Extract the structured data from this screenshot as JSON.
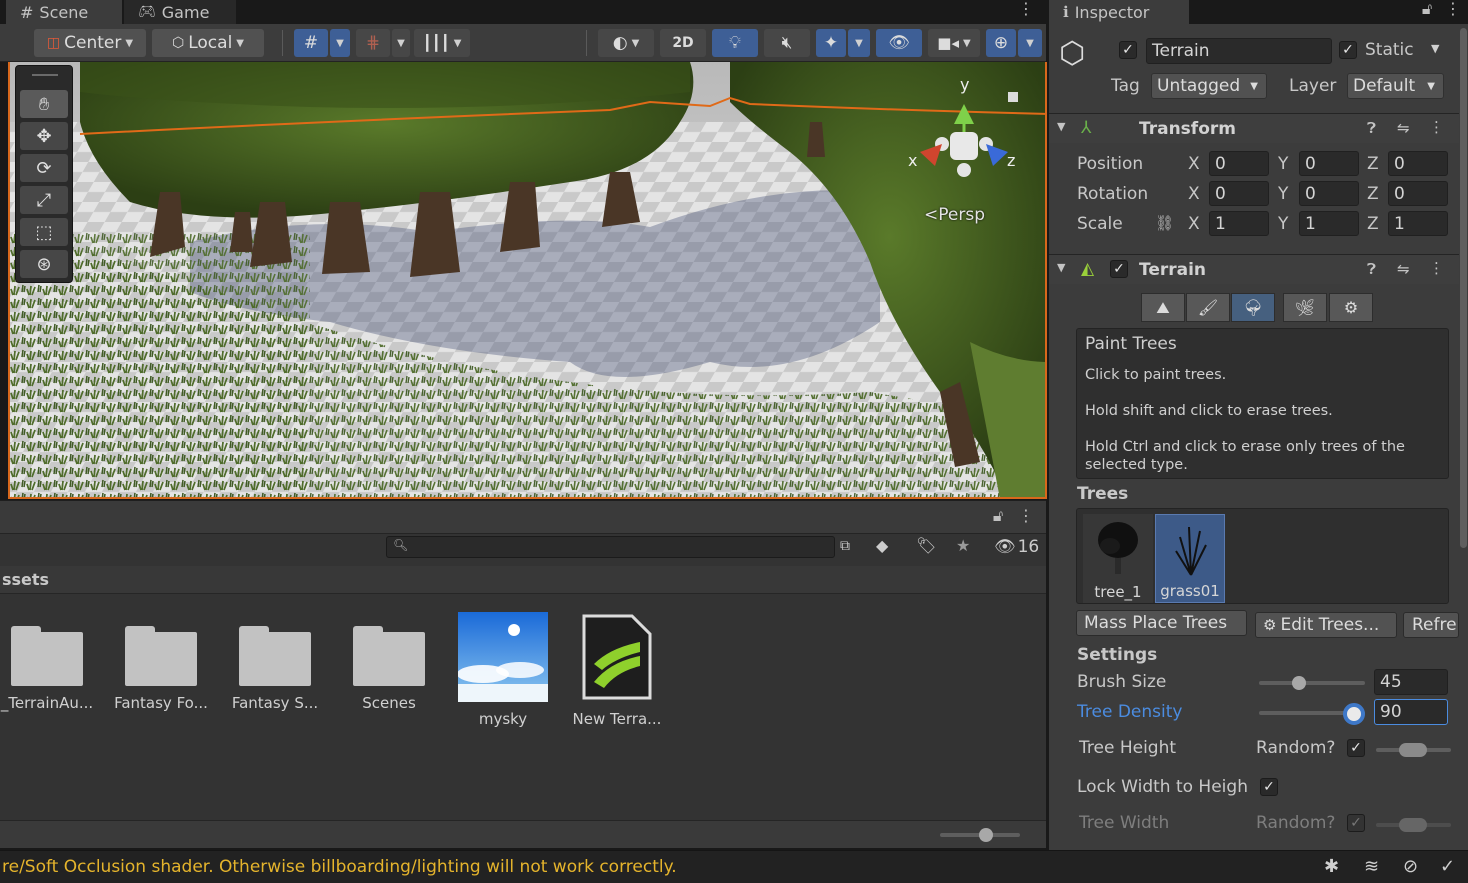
{
  "scene_window": {
    "tab_scene": "Scene",
    "tab_game": "Game",
    "pivot_mode": "Center",
    "pivot_rotation": "Local",
    "mode_2d": "2D",
    "orientation_label": "Persp",
    "gizmo_axes": {
      "x": "x",
      "y": "y",
      "z": "z"
    }
  },
  "project_window": {
    "search": {
      "value": "",
      "placeholder": ""
    },
    "hidden_count": "16",
    "breadcrumb": "ssets",
    "assets": [
      {
        "name": "_TerrainAu...",
        "kind": "folder"
      },
      {
        "name": "Fantasy Fo...",
        "kind": "folder"
      },
      {
        "name": "Fantasy S...",
        "kind": "folder"
      },
      {
        "name": "Scenes",
        "kind": "folder"
      },
      {
        "name": "mysky",
        "kind": "texture"
      },
      {
        "name": "New Terra...",
        "kind": "terrain-data"
      }
    ]
  },
  "status_bar": {
    "message": "re/Soft Occlusion shader. Otherwise billboarding/lighting will not work correctly."
  },
  "inspector": {
    "tab": "Inspector",
    "object": {
      "active": true,
      "name": "Terrain",
      "static_label": "Static",
      "static": true,
      "tag_label": "Tag",
      "tag": "Untagged",
      "layer_label": "Layer",
      "layer": "Default"
    },
    "transform": {
      "title": "Transform",
      "rows": [
        {
          "label": "Position",
          "x": "0",
          "y": "0",
          "z": "0"
        },
        {
          "label": "Rotation",
          "x": "0",
          "y": "0",
          "z": "0"
        },
        {
          "label": "Scale",
          "x": "1",
          "y": "1",
          "z": "1"
        }
      ],
      "axis": {
        "x": "X",
        "y": "Y",
        "z": "Z"
      }
    },
    "terrain": {
      "title": "Terrain",
      "enabled": true,
      "help_title": "Paint Trees",
      "help_lines": [
        "Click to paint trees.",
        "Hold shift and click to erase trees.",
        "Hold Ctrl and click to erase only trees of the",
        "selected type."
      ],
      "trees_label": "Trees",
      "trees": [
        {
          "name": "tree_1",
          "selected": false
        },
        {
          "name": "grass01",
          "selected": true
        }
      ],
      "mass_place_label": "Mass Place Trees",
      "edit_trees_label": "Edit Trees...",
      "refresh_label": "Refre",
      "settings_label": "Settings",
      "brush_size_label": "Brush Size",
      "brush_size": "45",
      "brush_size_fraction": 0.38,
      "tree_density_label": "Tree Density",
      "tree_density": "90",
      "tree_density_fraction": 0.9,
      "tree_height_label": "Tree Height",
      "random_label": "Random?",
      "lock_width_label": "Lock Width to Heigh",
      "tree_width_label": "Tree Width"
    }
  },
  "colors": {
    "selection_blue": "#3e5f96",
    "highlight_blue": "#4b8ce0",
    "warning_yellow": "#e5b42c",
    "selection_outline": "#d8681c"
  }
}
